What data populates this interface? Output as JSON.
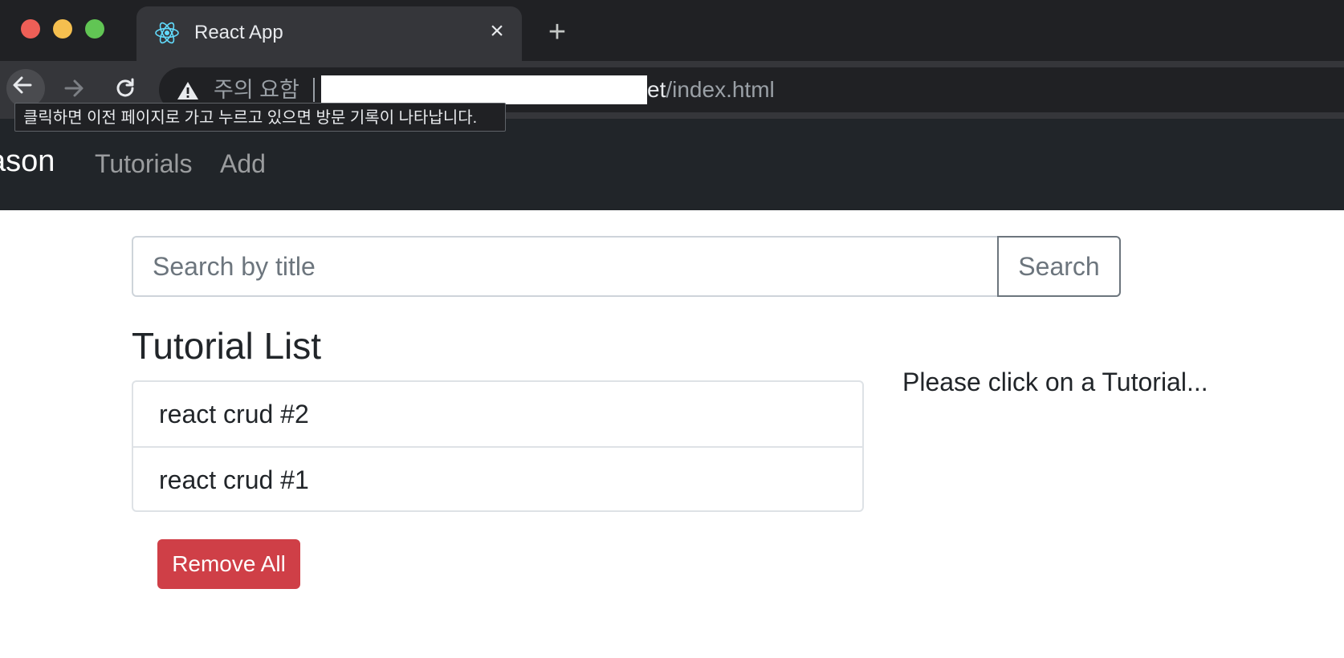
{
  "browser": {
    "tab": {
      "title": "React App",
      "icon": "react-logo-icon"
    },
    "tooltip": "클릭하면 이전 페이지로 가고 누르고 있으면 방문 기록이 나타납니다.",
    "address_bar": {
      "security_label": "주의 요함",
      "url_host_visible": "et",
      "url_path": "/index.html"
    }
  },
  "navbar": {
    "brand": "ason",
    "links": [
      {
        "label": "Tutorials"
      },
      {
        "label": "Add"
      }
    ]
  },
  "search": {
    "placeholder": "Search by title",
    "value": "",
    "button_label": "Search"
  },
  "tutorials": {
    "title": "Tutorial List",
    "items": [
      {
        "title": "react crud #2"
      },
      {
        "title": "react crud #1"
      }
    ],
    "remove_all_label": "Remove All"
  },
  "details": {
    "empty_message": "Please click on a Tutorial..."
  },
  "colors": {
    "navbar_bg": "#212529",
    "danger": "#cf3f47",
    "secondary": "#6c757d"
  }
}
